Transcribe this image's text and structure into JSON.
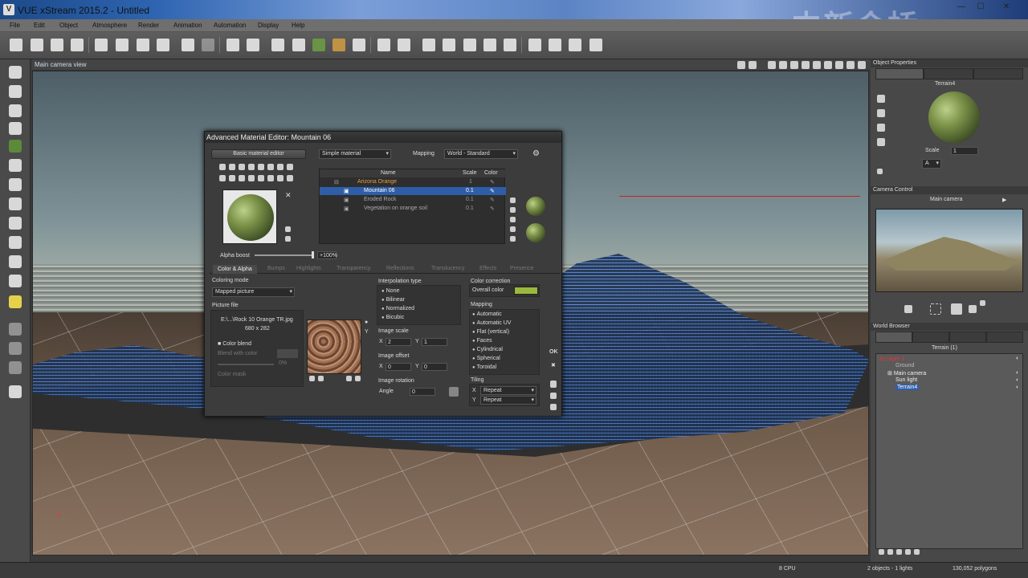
{
  "app": {
    "title": "VUE xStream 2015.2 - Untitled",
    "watermark": "中新金桥",
    "win_min": "—",
    "win_max": "☐",
    "win_close": "✕"
  },
  "menu": [
    "File",
    "Edit",
    "Object",
    "Atmosphere",
    "Render",
    "Animation",
    "Automation",
    "Display",
    "Help"
  ],
  "viewport": {
    "title": "Main camera view",
    "axis_label": "z\n└ x"
  },
  "dialog": {
    "title": "Advanced Material Editor: Mountain 06",
    "basic_button": "Basic material editor",
    "material_type": "Simple material",
    "mapping_label": "Mapping",
    "mapping_value": "World - Standard",
    "table": {
      "headers": [
        "Name",
        "Scale",
        "Color"
      ],
      "rows": [
        {
          "name": "Arizona Orange",
          "scale": "1"
        },
        {
          "name": "Mountain 06",
          "scale": "0.1"
        },
        {
          "name": "Eroded Rock",
          "scale": "0.1"
        },
        {
          "name": "Vegetation on orange soil",
          "scale": "0.1"
        }
      ],
      "selected_row": 1
    },
    "alpha_boost_label": "Alpha boost",
    "alpha_boost_value": "+100%",
    "tabs": [
      "Color & Alpha",
      "Bumps",
      "Highlights",
      "Transparency",
      "Reflections",
      "Translucency",
      "Effects",
      "Presence"
    ],
    "coloring_mode_label": "Coloring mode",
    "coloring_mode_value": "Mapped picture",
    "picture_file_label": "Picture file",
    "picture_path": "E:\\...\\Rock 10 Orange TR.jpg",
    "picture_dims": "680 x 282",
    "color_blend_label": "Color blend",
    "blend_with_color_label": "Blend with color",
    "blend_percent": "0%",
    "color_mask_label": "Color mask",
    "interpolation_label": "Interpolation type",
    "interpolation_options": [
      "None",
      "Bilinear",
      "Normalized",
      "Bicubic"
    ],
    "image_scale_label": "Image scale",
    "image_scale_x": "2",
    "image_scale_y": "1",
    "image_offset_label": "Image offset",
    "image_offset_x": "0",
    "image_offset_y": "0",
    "image_rotation_label": "Image rotation",
    "angle_label": "Angle",
    "angle_value": "0",
    "color_correction_label": "Color correction",
    "overall_color_label": "Overall color",
    "overall_color": "#9ab83e",
    "mapping2_label": "Mapping",
    "mapping_options": [
      "Automatic",
      "Automatic UV",
      "Flat (vertical)",
      "Faces",
      "Cylindrical",
      "Spherical",
      "Toroidal"
    ],
    "tiling_label": "Tiling",
    "tiling_x": "Repeat",
    "tiling_y": "Repeat",
    "ok": "OK",
    "cancel": "✖",
    "x_label": "X",
    "y_label": "Y"
  },
  "object_properties": {
    "header": "Object Properties",
    "object_name": "Terrain4",
    "scale_label": "Scale",
    "scale_value": "1",
    "mat_dropdown": "A"
  },
  "camera_control": {
    "header": "Camera Control",
    "camera_name": "Main camera"
  },
  "world_browser": {
    "header": "World Browser",
    "tab_label": "Terrain (1)",
    "items": [
      "Layer 1",
      "Ground",
      "Main camera",
      "Sun light",
      "Terrain4"
    ]
  },
  "status": {
    "cpu": "8 CPU",
    "objects": "2 objects - 1 lights",
    "polygons": "130,052 polygons"
  }
}
